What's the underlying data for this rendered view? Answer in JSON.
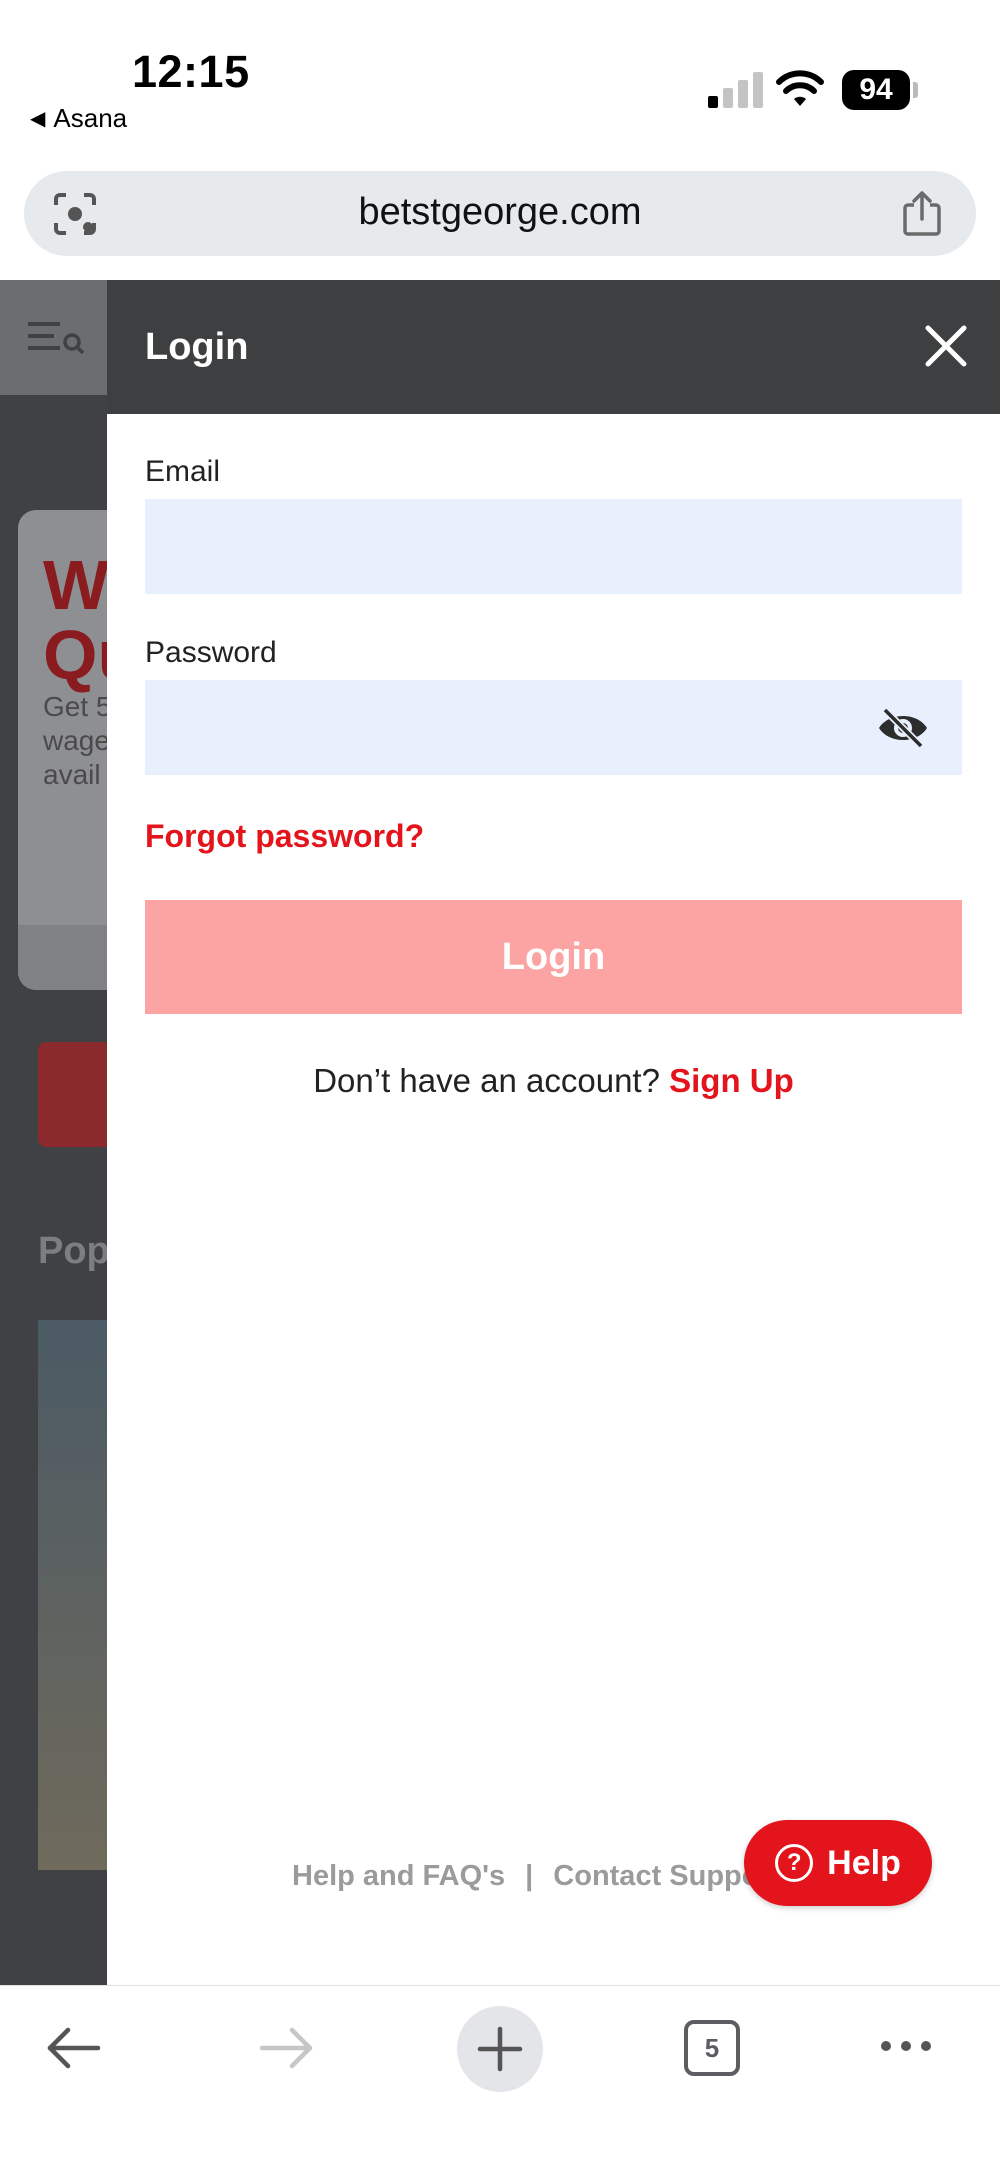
{
  "status_bar": {
    "time": "12:15",
    "back_app": "Asana",
    "battery": "94"
  },
  "browser": {
    "url": "betstgeorge.com",
    "tabs_count": "5"
  },
  "background_page": {
    "card_heading": "W\nQu",
    "card_text": "Get 5\nwage\navail",
    "popular_heading": "Pop"
  },
  "login_drawer": {
    "title": "Login",
    "email_label": "Email",
    "email_value": "",
    "password_label": "Password",
    "password_value": "",
    "forgot_password": "Forgot password?",
    "login_button": "Login",
    "no_account_text": "Don’t have an account?",
    "sign_up": "Sign Up",
    "footer_help": "Help and FAQ's",
    "footer_separator": "|",
    "footer_contact": "Contact Support",
    "help_button": "Help"
  },
  "colors": {
    "brand_red": "#e3141b",
    "login_button_disabled": "#fca4a4",
    "header_dark": "#3e3f41",
    "input_bg": "#e8f0fd"
  }
}
